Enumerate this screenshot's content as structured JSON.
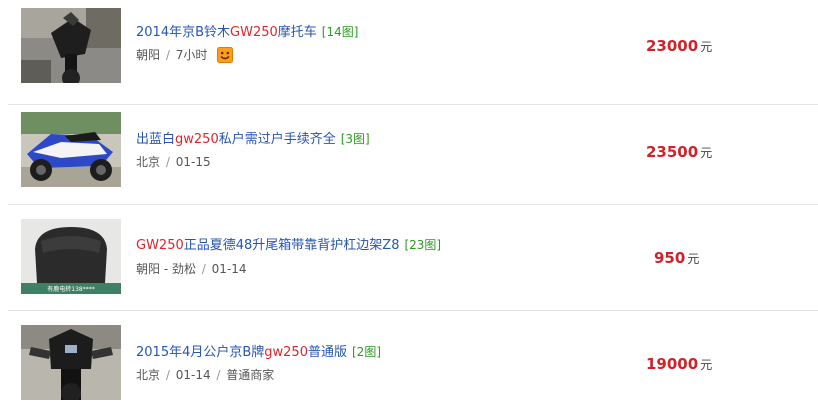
{
  "listings": [
    {
      "title_pre": "2014年京B铃木",
      "title_hl": "GW250",
      "title_post": "摩托车",
      "img_count": "[14图]",
      "location": "朝阳",
      "time": "7小时",
      "extra": "",
      "price": "23000",
      "unit": "元",
      "has_icon": true
    },
    {
      "title_pre": "出蓝白",
      "title_hl": "gw250",
      "title_post": "私户需过户手续齐全",
      "img_count": "[3图]",
      "location": "北京",
      "time": "01-15",
      "extra": "",
      "price": "23500",
      "unit": "元",
      "has_icon": false
    },
    {
      "title_pre": "",
      "title_hl": "GW250",
      "title_post": "正品夏德48升尾箱带靠背护杠边架Z8",
      "img_count": "[23图]",
      "location": "朝阳 - 劲松",
      "time": "01-14",
      "extra": "",
      "price": "950",
      "unit": "元",
      "has_icon": false
    },
    {
      "title_pre": "2015年4月公户京B牌",
      "title_hl": "gw250",
      "title_post": "普通版",
      "img_count": "[2图]",
      "location": "北京",
      "time": "01-14",
      "extra": "普通商家",
      "price": "19000",
      "unit": "元",
      "has_icon": false
    }
  ],
  "colors": {
    "title": "#2755b0",
    "highlight": "#e0242c",
    "img_count": "#2a9a20",
    "price": "#d1222b",
    "divider": "#e3e3e3"
  },
  "thumbnail_watermark": "有鹿电转138****"
}
